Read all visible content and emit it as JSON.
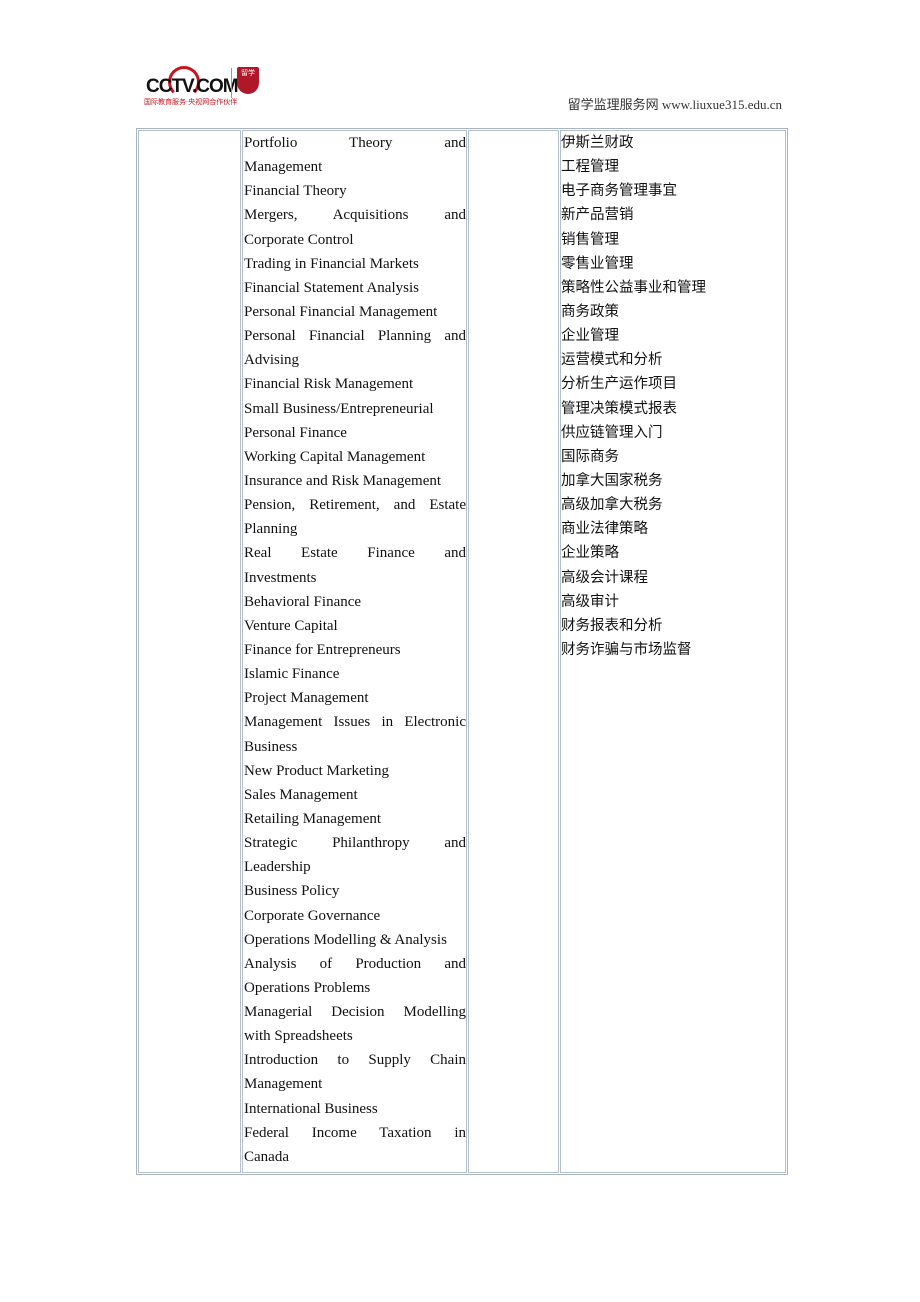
{
  "header": {
    "logo_text": "CCTV.COM",
    "logo_tagline": "国际教育服务·央视网合作伙伴",
    "logo_badge": "留学",
    "site_label": "留学监理服务网 www.liuxue315.edu.cn"
  },
  "courses_en": [
    [
      "Portfolio Theory and",
      "Management"
    ],
    [
      "Financial Theory"
    ],
    [
      "Mergers, Acquisitions and",
      "Corporate Control"
    ],
    [
      "Trading in Financial Markets"
    ],
    [
      "Financial Statement Analysis"
    ],
    [
      "Personal Financial Management"
    ],
    [
      "Personal Financial Planning and",
      "Advising"
    ],
    [
      "Financial Risk Management"
    ],
    [
      "Small Business/Entrepreneurial"
    ],
    [
      "Personal Finance"
    ],
    [
      "Working Capital Management"
    ],
    [
      "Insurance and Risk Management"
    ],
    [
      "Pension, Retirement, and Estate",
      "Planning"
    ],
    [
      "Real Estate Finance and",
      "Investments"
    ],
    [
      "Behavioral Finance"
    ],
    [
      "Venture Capital"
    ],
    [
      "Finance for Entrepreneurs"
    ],
    [
      "Islamic Finance"
    ],
    [
      "Project Management"
    ],
    [
      "Management Issues in Electronic",
      "Business"
    ],
    [
      "New Product Marketing"
    ],
    [
      "Sales Management"
    ],
    [
      "Retailing Management"
    ],
    [
      "Strategic Philanthropy and",
      "Leadership"
    ],
    [
      "Business Policy"
    ],
    [
      "Corporate Governance"
    ],
    [
      "Operations Modelling & Analysis"
    ],
    [
      "Analysis of Production and",
      "Operations Problems"
    ],
    [
      "Managerial Decision Modelling",
      "with Spreadsheets"
    ],
    [
      "Introduction to Supply Chain",
      "Management"
    ],
    [
      "International Business"
    ],
    [
      "Federal Income Taxation in",
      "Canada"
    ]
  ],
  "courses_zh": [
    "伊斯兰财政",
    "工程管理",
    "电子商务管理事宜",
    "新产品营销",
    "销售管理",
    "零售业管理",
    "策略性公益事业和管理",
    "商务政策",
    "企业管理",
    "运营模式和分析",
    "分析生产运作项目",
    "管理决策模式报表",
    "供应链管理入门",
    "国际商务",
    "加拿大国家税务",
    "高级加拿大税务",
    "商业法律策略",
    "企业策略",
    "高级会计课程",
    "高级审计",
    "财务报表和分析",
    "财务诈骗与市场监督"
  ]
}
